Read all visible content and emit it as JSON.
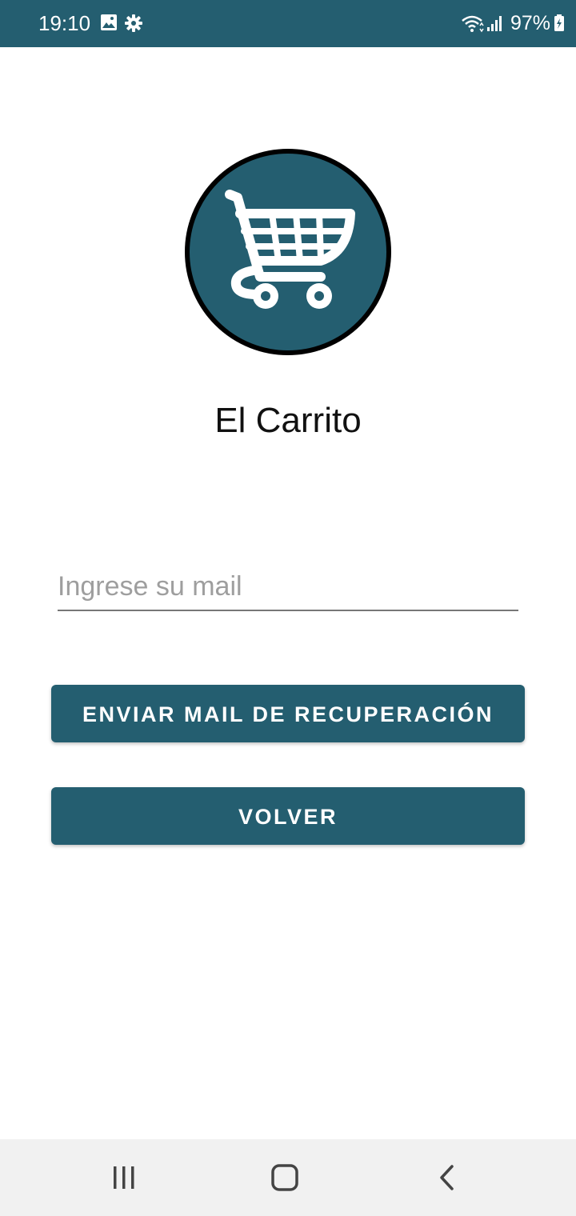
{
  "status_bar": {
    "time": "19:10",
    "battery_text": "97%",
    "icons": [
      "image-icon",
      "gear-icon",
      "wifi-icon",
      "signal-icon",
      "battery-charging-icon"
    ],
    "background": "#245e70"
  },
  "logo": {
    "icon": "shopping-cart-icon",
    "circle_color": "#245e70",
    "border_color": "#000000"
  },
  "app": {
    "title": "El Carrito"
  },
  "form": {
    "email_placeholder": "Ingrese su mail",
    "email_value": ""
  },
  "buttons": {
    "send_label": "ENVIAR MAIL DE RECUPERACIÓN",
    "back_label": "VOLVER",
    "color": "#245e70"
  },
  "nav_bar": {
    "icons": [
      "recents-icon",
      "home-icon",
      "back-icon"
    ]
  }
}
